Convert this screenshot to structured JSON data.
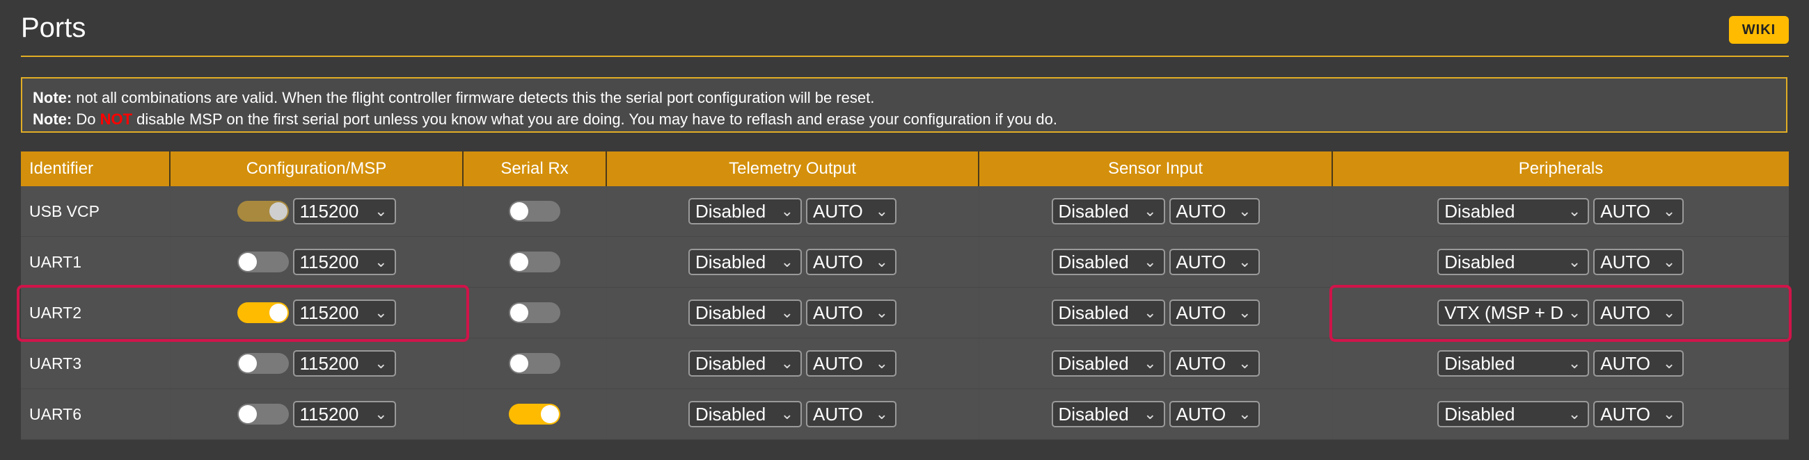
{
  "page": {
    "title": "Ports",
    "wiki_label": "WIKI"
  },
  "note": {
    "line1_prefix": "Note:",
    "line1_text": " not all combinations are valid. When the flight controller firmware detects this the serial port configuration will be reset.",
    "line2_prefix": "Note:",
    "line2_text_a": " Do ",
    "line2_not": "NOT",
    "line2_text_b": " disable MSP on the first serial port unless you know what you are doing. You may have to reflash and erase your configuration if you do."
  },
  "table": {
    "headers": [
      "Identifier",
      "Configuration/MSP",
      "Serial Rx",
      "Telemetry Output",
      "Sensor Input",
      "Peripherals"
    ],
    "rows": [
      {
        "id": "USB VCP",
        "msp": "dim",
        "baud": "115200",
        "serial_rx": false,
        "telemetry": "Disabled",
        "telemetry_baud": "AUTO",
        "sensor": "Disabled",
        "sensor_baud": "AUTO",
        "peripheral": "Disabled",
        "peripheral_baud": "AUTO"
      },
      {
        "id": "UART1",
        "msp": "off",
        "baud": "115200",
        "serial_rx": false,
        "telemetry": "Disabled",
        "telemetry_baud": "AUTO",
        "sensor": "Disabled",
        "sensor_baud": "AUTO",
        "peripheral": "Disabled",
        "peripheral_baud": "AUTO"
      },
      {
        "id": "UART2",
        "msp": "on",
        "baud": "115200",
        "serial_rx": false,
        "telemetry": "Disabled",
        "telemetry_baud": "AUTO",
        "sensor": "Disabled",
        "sensor_baud": "AUTO",
        "peripheral": "VTX (MSP + D",
        "peripheral_baud": "AUTO"
      },
      {
        "id": "UART3",
        "msp": "off",
        "baud": "115200",
        "serial_rx": false,
        "telemetry": "Disabled",
        "telemetry_baud": "AUTO",
        "sensor": "Disabled",
        "sensor_baud": "AUTO",
        "peripheral": "Disabled",
        "peripheral_baud": "AUTO"
      },
      {
        "id": "UART6",
        "msp": "off",
        "baud": "115200",
        "serial_rx": true,
        "telemetry": "Disabled",
        "telemetry_baud": "AUTO",
        "sensor": "Disabled",
        "sensor_baud": "AUTO",
        "peripheral": "Disabled",
        "peripheral_baud": "AUTO"
      }
    ]
  },
  "colors": {
    "accent": "#ffbb00",
    "header_bg": "#d4900c",
    "highlight": "#d0144a",
    "background": "#3a3a3a"
  },
  "icons": {
    "select_arrow": "chevron-down-icon"
  }
}
